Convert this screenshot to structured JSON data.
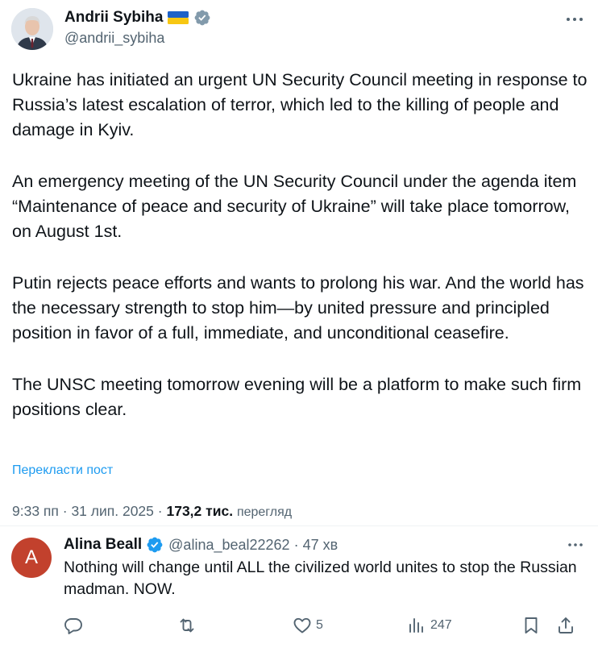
{
  "post": {
    "author_name": "Andrii Sybiha",
    "author_handle": "@andrii_sybiha",
    "paragraphs": [
      "Ukraine has initiated an urgent UN Security Council meeting in response to Russia’s latest escalation of terror, which led to the killing of people and damage in Kyiv.",
      "An emergency meeting of the UN Security Council under the agenda item “Maintenance of peace and security of Ukraine” will take place tomorrow, on August 1st.",
      "Putin rejects peace efforts and wants to prolong his war. And the world has the necessary strength to stop him—by united pressure and principled position in favor of a full, immediate, and unconditional ceasefire.",
      "The UNSC meeting tomorrow evening will be a platform to make such firm positions clear."
    ],
    "translate_label": "Перекласти пост",
    "time": "9:33 пп",
    "separator": "·",
    "date": "31 лип. 2025",
    "views_count": "173,2 тис.",
    "views_label": "перегляд"
  },
  "reply": {
    "avatar_letter": "A",
    "avatar_color": "#c2412d",
    "author_name": "Alina Beall",
    "author_handle": "@alina_beal22262",
    "separator": "·",
    "time_ago": "47 хв",
    "text": "Nothing will change until ALL the civilized world unites to stop the Russian madman.  NOW.",
    "actions": {
      "reply_icon": "reply-icon",
      "repost_icon": "repost-icon",
      "like_icon": "heart-icon",
      "like_count": "5",
      "views_icon": "bar-chart-icon",
      "views_count": "247",
      "bookmark_icon": "bookmark-icon",
      "share_icon": "share-icon"
    }
  },
  "colors": {
    "text_primary": "#0f1419",
    "text_secondary": "#536471",
    "link": "#1d9bf0",
    "verified": "#829aab",
    "reply_verified": "#1d9bf0",
    "divider": "#eff3f4"
  }
}
